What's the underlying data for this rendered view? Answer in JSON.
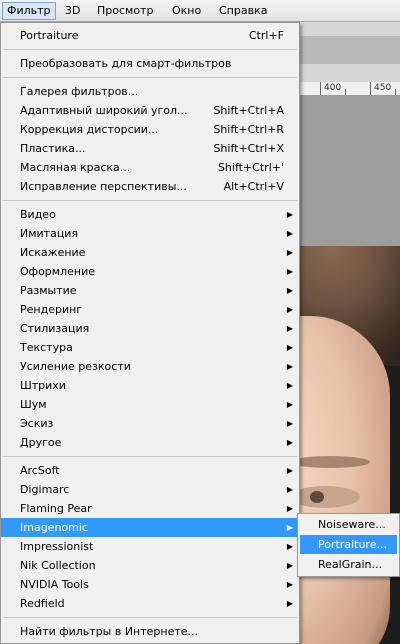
{
  "menubar": {
    "items": [
      {
        "label": "Фильтр"
      },
      {
        "label": "3D"
      },
      {
        "label": "Просмотр"
      },
      {
        "label": "Окно"
      },
      {
        "label": "Справка"
      }
    ]
  },
  "ruler": {
    "marks": [
      "400",
      "450"
    ]
  },
  "menu": {
    "group1": [
      {
        "label": "Portraiture",
        "shortcut": "Ctrl+F"
      }
    ],
    "group2": [
      {
        "label": "Преобразовать для смарт-фильтров"
      }
    ],
    "group3": [
      {
        "label": "Галерея фильтров..."
      },
      {
        "label": "Адаптивный широкий угол...",
        "shortcut": "Shift+Ctrl+A"
      },
      {
        "label": "Коррекция дисторсии...",
        "shortcut": "Shift+Ctrl+R"
      },
      {
        "label": "Пластика...",
        "shortcut": "Shift+Ctrl+X"
      },
      {
        "label": "Масляная краска...",
        "shortcut": "Shift+Ctrl+'"
      },
      {
        "label": "Исправление перспективы...",
        "shortcut": "Alt+Ctrl+V"
      }
    ],
    "group4": [
      {
        "label": "Видео"
      },
      {
        "label": "Имитация"
      },
      {
        "label": "Искажение"
      },
      {
        "label": "Оформление"
      },
      {
        "label": "Размытие"
      },
      {
        "label": "Рендеринг"
      },
      {
        "label": "Стилизация"
      },
      {
        "label": "Текстура"
      },
      {
        "label": "Усиление резкости"
      },
      {
        "label": "Штрихи"
      },
      {
        "label": "Шум"
      },
      {
        "label": "Эскиз"
      },
      {
        "label": "Другое"
      }
    ],
    "group5": [
      {
        "label": "ArcSoft"
      },
      {
        "label": "Digimarc"
      },
      {
        "label": "Flaming Pear"
      },
      {
        "label": "Imagenomic"
      },
      {
        "label": "Impressionist"
      },
      {
        "label": "Nik Collection"
      },
      {
        "label": "NVIDIA Tools"
      },
      {
        "label": "Redfield"
      }
    ],
    "group6": [
      {
        "label": "Найти фильтры в Интернете..."
      }
    ]
  },
  "submenu": {
    "items": [
      {
        "label": "Noiseware..."
      },
      {
        "label": "Portraiture..."
      },
      {
        "label": "RealGrain..."
      }
    ]
  },
  "colors": {
    "highlight": "#3399ff",
    "menu_bg": "#f0f0f0"
  }
}
